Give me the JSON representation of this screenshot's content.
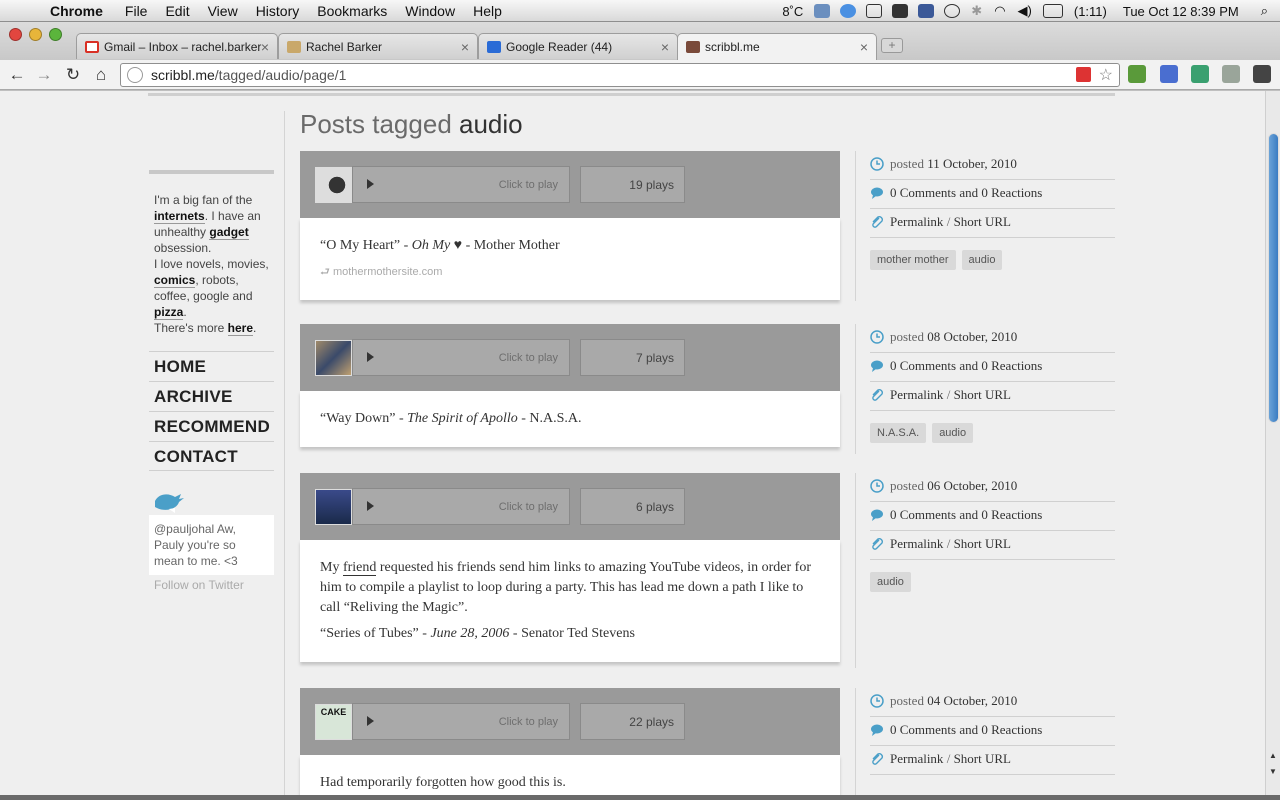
{
  "menubar": {
    "app": "Chrome",
    "menus": [
      "File",
      "Edit",
      "View",
      "History",
      "Bookmarks",
      "Window",
      "Help"
    ],
    "temp": "8˚C",
    "battery": "(1:11)",
    "clock": "Tue Oct 12  8:39 PM"
  },
  "tabs": [
    {
      "title": "Gmail – Inbox – rachel.barker",
      "fav_color": "#d93025"
    },
    {
      "title": "Rachel Barker",
      "fav_color": "#8a6d3b"
    },
    {
      "title": "Google Reader (44)",
      "fav_color": "#2a6bd6"
    },
    {
      "title": "scribbl.me",
      "fav_color": "#7a4a3a"
    }
  ],
  "address": {
    "host": "scribbl.me",
    "path": "/tagged/audio/page/1"
  },
  "sidebar": {
    "bio": {
      "t1": "I'm a big fan of the ",
      "l1": "internets",
      "t2": ". I have an unhealthy ",
      "l2": "gadget",
      "t3": " obsession.",
      "t4": "I love novels, movies, ",
      "l3": "comics",
      "t5": ", robots, coffee, google and ",
      "l4": "pizza",
      "t6": ".",
      "t7": "There's more ",
      "l5": "here",
      "t8": "."
    },
    "nav": [
      "HOME",
      "ARCHIVE",
      "RECOMMEND",
      "CONTACT"
    ],
    "tweet": "@pauljohal Aw, Pauly you're so mean to me. <3",
    "follow": "Follow on Twitter"
  },
  "heading": {
    "prefix": "Posts tagged ",
    "tag": "audio"
  },
  "player": {
    "click_to_play": "Click to play"
  },
  "posts": [
    {
      "plays": "19 plays",
      "title": "“O My Heart”",
      "sep1": " - ",
      "album": "Oh My ♥",
      "sep2": " - ",
      "artist": "Mother Mother",
      "source": "mothermothersite.com",
      "date_prefix": "posted ",
      "date": "11 October, 2010",
      "comments": "0 Comments and 0 Reactions",
      "permalink": "Permalink",
      "slash": " / ",
      "short_url": "Short URL",
      "tags": [
        "mother mother",
        "audio"
      ]
    },
    {
      "plays": "7 plays",
      "title": "“Way Down”",
      "sep1": " - ",
      "album": "The Spirit of Apollo",
      "sep2": " - ",
      "artist": "N.A.S.A.",
      "date_prefix": "posted ",
      "date": "08 October, 2010",
      "comments": "0 Comments and 0 Reactions",
      "permalink": "Permalink",
      "slash": " / ",
      "short_url": "Short URL",
      "tags": [
        "N.A.S.A.",
        "audio"
      ]
    },
    {
      "plays": "6 plays",
      "intro_a": "My ",
      "intro_link": "friend",
      "intro_b": " requested his friends send him links to amazing YouTube videos, in order for him to compile a playlist to loop during a party. This has lead me down a path I like to call “Reliving the Magic”.",
      "title": "“Series of Tubes”",
      "sep1": " - ",
      "album": "June 28, 2006",
      "sep2": " - ",
      "artist": "Senator Ted Stevens",
      "date_prefix": "posted ",
      "date": "06 October, 2010",
      "comments": "0 Comments and 0 Reactions",
      "permalink": "Permalink",
      "slash": " / ",
      "short_url": "Short URL",
      "tags": [
        "audio"
      ]
    },
    {
      "plays": "22 plays",
      "thumb_text": "CAKE",
      "intro": "Had temporarily forgotten how good this is.",
      "date_prefix": "posted ",
      "date": "04 October, 2010",
      "comments": "0 Comments and 0 Reactions",
      "permalink": "Permalink",
      "slash": " / ",
      "short_url": "Short URL"
    }
  ],
  "colors": {
    "accent": "#4a9fc8",
    "player_bg": "#9a9a9a"
  }
}
